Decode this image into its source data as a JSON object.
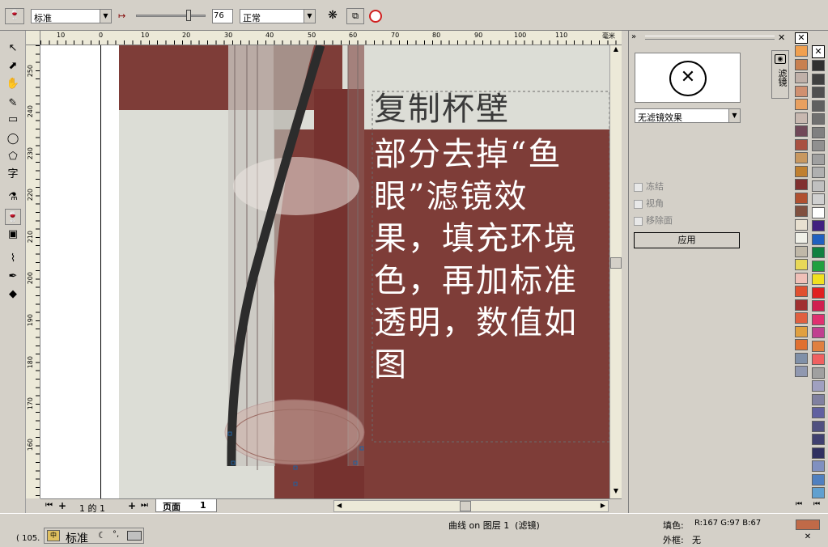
{
  "propbar": {
    "preset_value": "标准",
    "blend_value": "76",
    "mode_value": "正常"
  },
  "ruler": {
    "h_labels": [
      "10",
      "0",
      "10",
      "20",
      "30",
      "40",
      "50",
      "60",
      "70",
      "80",
      "90",
      "100",
      "110"
    ],
    "h_unit": "毫米",
    "v_labels": [
      "250",
      "240",
      "230",
      "220",
      "210",
      "200",
      "190",
      "180",
      "170",
      "160"
    ]
  },
  "canvas_text": {
    "title": "复制杯壁",
    "body_lines": [
      "部分去掉“鱼",
      "眼”滤镜效",
      "果，填充环境",
      "色，再加标准",
      "透明，数值如",
      "图"
    ]
  },
  "page_nav": {
    "count": "1 的 1",
    "tab": "页面",
    "tab_num": "1"
  },
  "docker": {
    "tab_label": "滤镜",
    "filter_select": "无滤镜效果",
    "freeze": "冻结",
    "viewpoint": "视角",
    "remove_face": "移除面",
    "apply": "应用"
  },
  "status": {
    "coords": "( 105.",
    "lang_label": "标准",
    "object_info": "曲线 on 图层 1  (滤镜)",
    "fill_label": "填色:",
    "fill_value": "R:167 G:97 B:67",
    "outline_label": "外框:",
    "outline_value": "无"
  },
  "colors": {
    "maroon": "#7a3a36",
    "fill_swatch": "#c06a48"
  },
  "palette": [
    "#f0a050",
    "#c88050",
    "#c0b0a8",
    "#d09070",
    "#e8a060",
    "#c8b8b0",
    "#704858",
    "#a85040",
    "#c89860",
    "#c08030",
    "#803030",
    "#b05030",
    "#805040",
    "#e8e0d0",
    "#f0f0e8",
    "#c0b8a8",
    "#e8d858",
    "#f0c0b8",
    "#e05030",
    "#a03030",
    "#e06040",
    "#e0a040",
    "#e07030",
    "#8090a8",
    "#9098b0"
  ],
  "palette2": [
    "#303030",
    "#404040",
    "#505050",
    "#606060",
    "#707070",
    "#808080",
    "#909090",
    "#a0a0a0",
    "#b0b0b0",
    "#c0c0c0",
    "#d0d0d0",
    "#ffffff",
    "#402080",
    "#2060c0",
    "#108040",
    "#20a040",
    "#f0e020",
    "#e02020",
    "#d02050",
    "#e03070",
    "#c04090",
    "#e08040",
    "#f06060",
    "#a0a0a0",
    "#a0a0c0",
    "#8080a0",
    "#6060a0",
    "#505080",
    "#404070",
    "#303060",
    "#8090c0",
    "#5080c0",
    "#60a0d0"
  ]
}
